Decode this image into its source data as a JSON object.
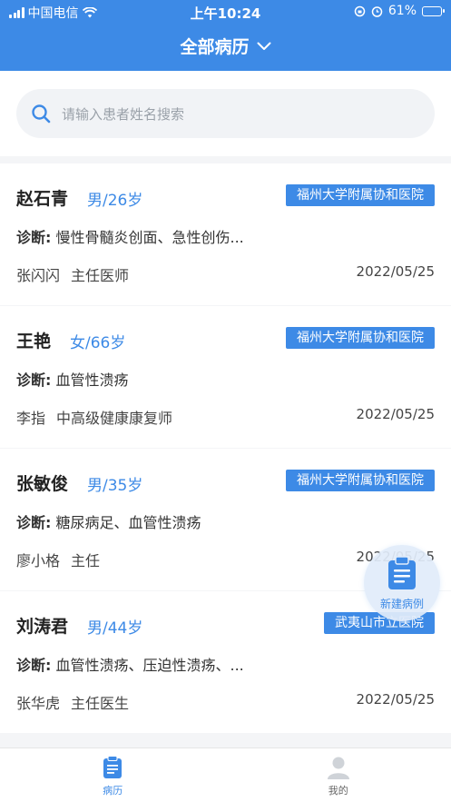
{
  "status_bar": {
    "carrier": "中国电信",
    "time": "上午10:24",
    "battery": "61%",
    "battery_level": 0.61
  },
  "header": {
    "title": "全部病历"
  },
  "search": {
    "placeholder": "请输入患者姓名搜索"
  },
  "records": [
    {
      "name": "赵石青",
      "gender_age": "男/26岁",
      "hospital": "福州大学附属协和医院",
      "diagnosis_label": "诊断:",
      "diagnosis": "慢性骨髓炎创面、急性创伤...",
      "doctor": "张闪闪",
      "doctor_title": "主任医师",
      "date": "2022/05/25"
    },
    {
      "name": "王艳",
      "gender_age": "女/66岁",
      "hospital": "福州大学附属协和医院",
      "diagnosis_label": "诊断:",
      "diagnosis": "血管性溃疡",
      "doctor": "李指",
      "doctor_title": "中高级健康康复师",
      "date": "2022/05/25"
    },
    {
      "name": "张敏俊",
      "gender_age": "男/35岁",
      "hospital": "福州大学附属协和医院",
      "diagnosis_label": "诊断:",
      "diagnosis": "糖尿病足、血管性溃疡",
      "doctor": "廖小格",
      "doctor_title": "主任",
      "date": "2022/05/25"
    },
    {
      "name": "刘涛君",
      "gender_age": "男/44岁",
      "hospital": "武夷山市立医院",
      "diagnosis_label": "诊断:",
      "diagnosis": "血管性溃疡、压迫性溃疡、...",
      "doctor": "张华虎",
      "doctor_title": "主任医生",
      "date": "2022/05/25"
    }
  ],
  "fab": {
    "label": "新建病例",
    "icon": "clipboard-icon"
  },
  "tabbar": {
    "tabs": [
      {
        "label": "病历",
        "icon": "clipboard-icon",
        "active": true
      },
      {
        "label": "我的",
        "icon": "user-icon",
        "active": false
      }
    ]
  },
  "colors": {
    "primary": "#3d8ae6",
    "background": "#f4f5f7"
  }
}
